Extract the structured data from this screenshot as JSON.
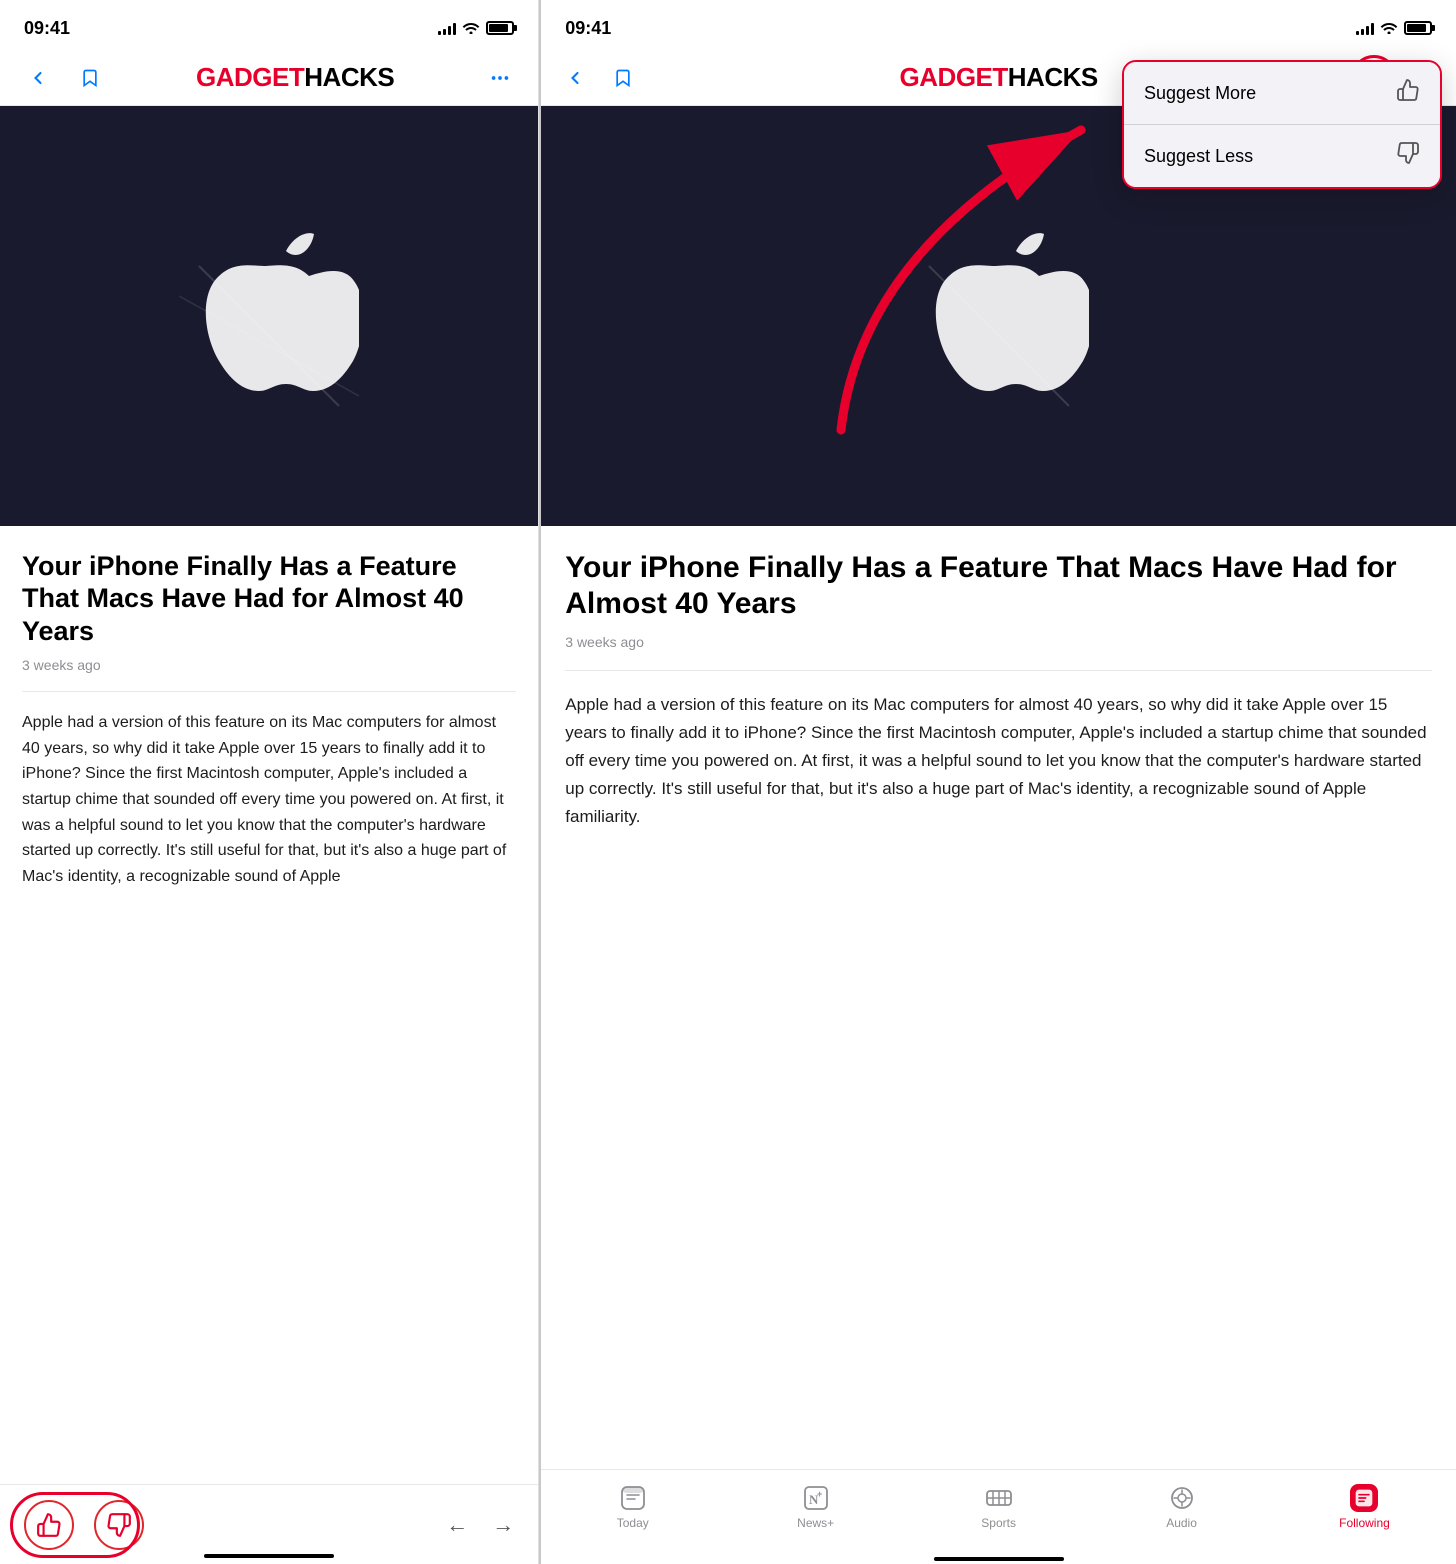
{
  "left_phone": {
    "status_bar": {
      "time": "09:41"
    },
    "nav": {
      "back_label": "‹",
      "bookmark_label": "🔖",
      "brand_gadget": "GADGET",
      "brand_hacks": "HACKS",
      "more_label": "···"
    },
    "article": {
      "title": "Your iPhone Finally Has a Feature That Macs Have Had for Almost 40 Years",
      "time": "3 weeks ago",
      "body": "Apple had a version of this feature on its Mac computers for almost 40 years, so why did it take Apple over 15 years to finally add it to iPhone? Since the first Macintosh computer, Apple's included a startup chime that sounded off every time you powered on. At first, it was a helpful sound to let you know that the computer's hardware started up correctly. It's still useful for that, but it's also a huge part of Mac's identity, a recognizable sound of Apple"
    },
    "bottom_bar": {
      "thumbs_up": "👍",
      "thumbs_down": "👎",
      "back_arrow": "←",
      "forward_arrow": "→"
    }
  },
  "right_phone": {
    "status_bar": {
      "time": "09:41"
    },
    "nav": {
      "back_label": "‹",
      "bookmark_label": "🔖",
      "brand_gadget": "GADGET",
      "brand_hacks": "HACKS",
      "more_label": "···"
    },
    "dropdown": {
      "suggest_more": "Suggest More",
      "suggest_less": "Suggest Less"
    },
    "article": {
      "title": "Your iPhone Finally Has a Feature That Macs Have Had for Almost 40 Years",
      "time": "3 weeks ago",
      "body": "Apple had a version of this feature on its Mac computers for almost 40 years, so why did it take Apple over 15 years to finally add it to iPhone? Since the first Macintosh computer, Apple's included a startup chime that sounded off every time you powered on. At first, it was a helpful sound to let you know that the computer's hardware started up correctly. It's still useful for that, but it's also a huge part of Mac's identity, a recognizable sound of Apple familiarity."
    },
    "tab_bar": {
      "items": [
        {
          "label": "Today",
          "icon": "news-today"
        },
        {
          "label": "News+",
          "icon": "news-plus"
        },
        {
          "label": "Sports",
          "icon": "sports"
        },
        {
          "label": "Audio",
          "icon": "audio"
        },
        {
          "label": "Following",
          "icon": "following",
          "active": true
        }
      ]
    }
  }
}
